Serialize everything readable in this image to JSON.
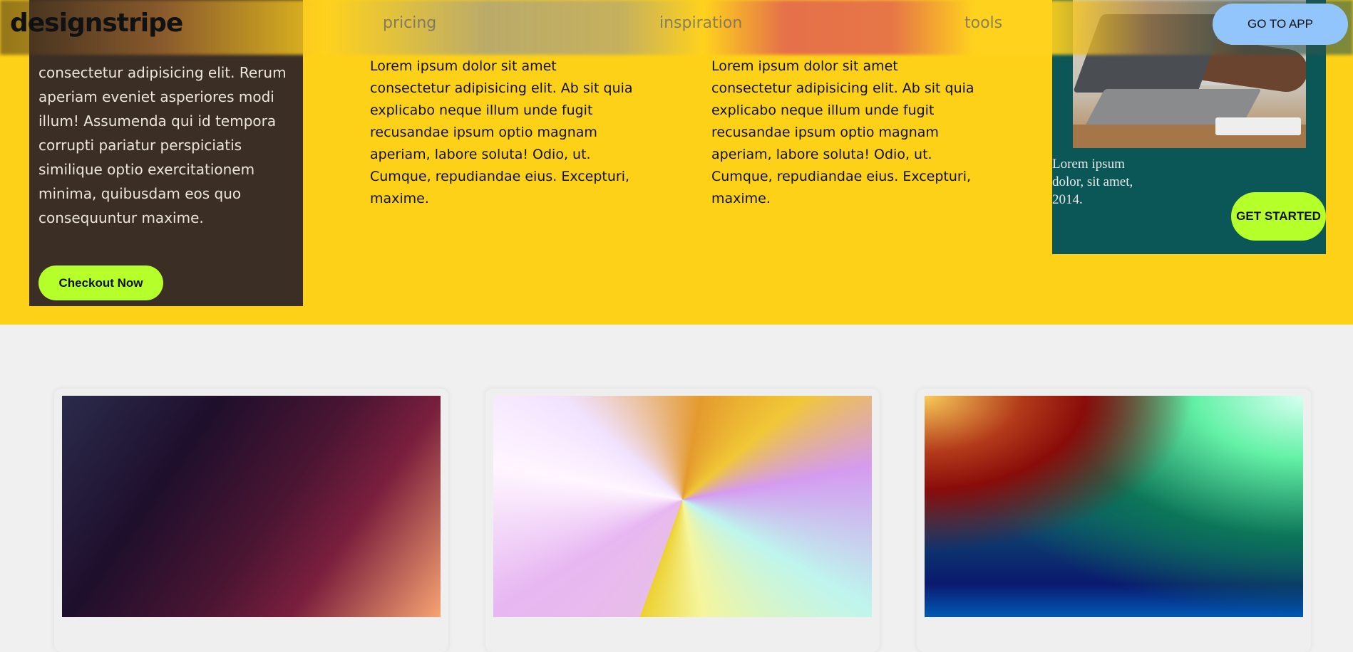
{
  "header": {
    "logo": "designstripe",
    "nav": [
      "pricing",
      "inspiration",
      "tools"
    ],
    "cta": "GO TO APP"
  },
  "hero": {
    "dark_card": {
      "text": "consectetur adipisicing elit. Rerum aperiam eveniet asperiores modi illum! Assumenda qui id tempora corrupti pariatur perspiciatis similique optio exercitationem minima, quibusdam eos quo consequuntur maxime.",
      "button": "Checkout Now"
    },
    "columns": [
      "Lorem ipsum dolor sit amet consectetur adipisicing elit. Ab sit quia explicabo neque illum unde fugit recusandae ipsum optio magnam aperiam, labore soluta! Odio, ut. Cumque, repudiandae eius. Excepturi, maxime.",
      "Lorem ipsum dolor sit amet consectetur adipisicing elit. Ab sit quia explicabo neque illum unde fugit recusandae ipsum optio magnam aperiam, labore soluta! Odio, ut. Cumque, repudiandae eius. Excepturi, maxime."
    ],
    "teal_card": {
      "caption": "Lorem ipsum dolor, sit amet, 2014.",
      "button": "GET STARTED"
    }
  },
  "colors": {
    "hero_bg": "#fed119",
    "accent_green": "#b5ff2a",
    "cta_blue": "#93c5fd",
    "dark_card": "#3b2e24",
    "teal_card": "#0b5657"
  }
}
